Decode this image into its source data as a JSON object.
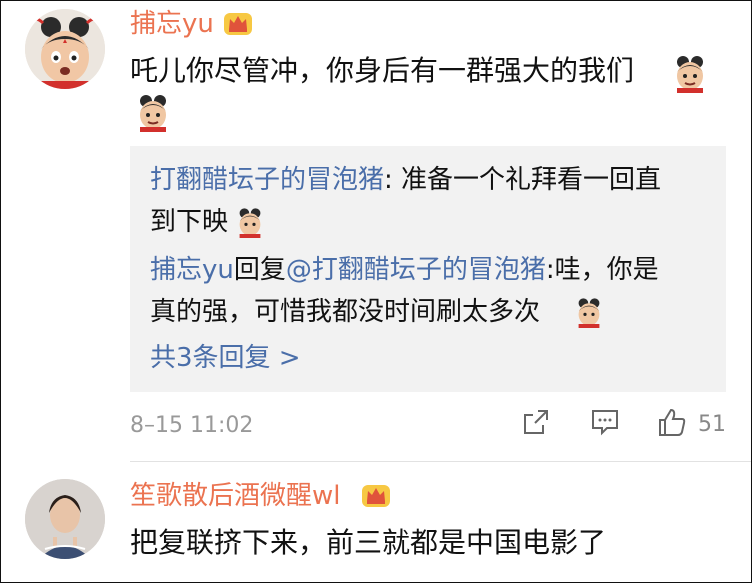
{
  "comments": [
    {
      "username": "捕忘yu",
      "text": "吒儿你尽管冲，你身后有一群强大的我们",
      "timestamp": "8–15 11:02",
      "like_count": "51",
      "replies": {
        "line1": {
          "author": "打翻醋坛子的冒泡猪",
          "text": ": 准备一个礼拜看一回直"
        },
        "line2": "到下映",
        "line3": {
          "author": "捕忘yu",
          "middle": "回复",
          "mention": "@打翻醋坛子的冒泡猪",
          "text": ":哇，你是"
        },
        "line4": "真的强，可惜我都没时间刷太多次",
        "more": "共3条回复 >"
      }
    },
    {
      "username": "笙歌散后酒微醒wl",
      "text": "把复联挤下来，前三就都是中国电影了"
    }
  ],
  "colors": {
    "username": "#eb7350",
    "link": "#4a6ea9",
    "meta": "#999999",
    "reply_bg": "#f2f2f2"
  },
  "icons": [
    "crown-badge-icon",
    "nezha-emoji",
    "share-icon",
    "comment-icon",
    "like-icon"
  ]
}
